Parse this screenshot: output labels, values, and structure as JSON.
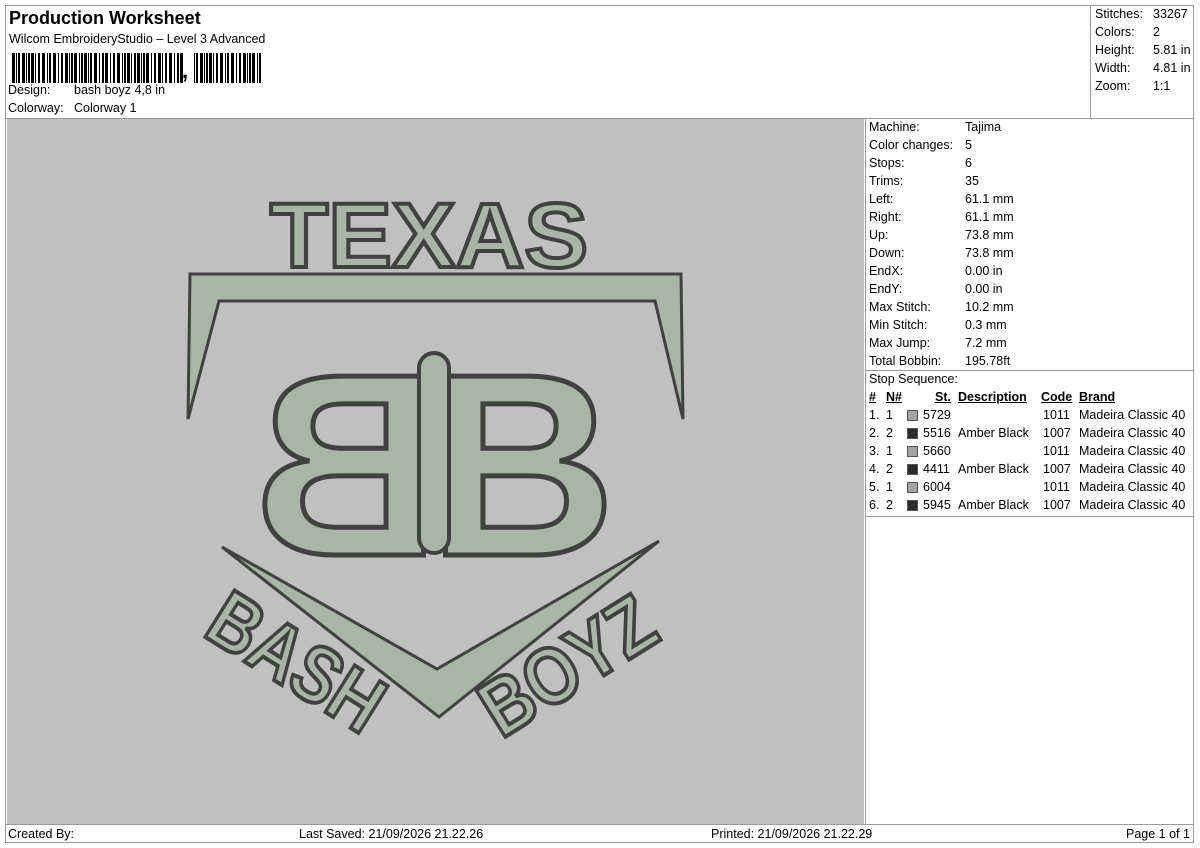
{
  "header": {
    "title": "Production Worksheet",
    "software": "Wilcom EmbroideryStudio – Level 3 Advanced",
    "barcode_tail": ",",
    "design_label": "Design:",
    "design_value": "bash boyz 4,8 in",
    "colorway_label": "Colorway:",
    "colorway_value": "Colorway 1"
  },
  "stats": [
    {
      "label": "Stitches:",
      "value": "33267"
    },
    {
      "label": "Colors:",
      "value": "2"
    },
    {
      "label": "Height:",
      "value": "5.81 in"
    },
    {
      "label": "Width:",
      "value": "4.81 in"
    },
    {
      "label": "Zoom:",
      "value": "1:1"
    }
  ],
  "machine_info": [
    {
      "label": "Machine:",
      "value": "Tajima"
    },
    {
      "label": "Color changes:",
      "value": "5"
    },
    {
      "label": "Stops:",
      "value": "6"
    },
    {
      "label": "Trims:",
      "value": "35"
    },
    {
      "label": "Left:",
      "value": "61.1 mm"
    },
    {
      "label": "Right:",
      "value": "61.1 mm"
    },
    {
      "label": "Up:",
      "value": "73.8 mm"
    },
    {
      "label": "Down:",
      "value": "73.8 mm"
    },
    {
      "label": "EndX:",
      "value": "0.00 in"
    },
    {
      "label": "EndY:",
      "value": "0.00 in"
    },
    {
      "label": "Max Stitch:",
      "value": "10.2 mm"
    },
    {
      "label": "Min Stitch:",
      "value": "0.3 mm"
    },
    {
      "label": "Max Jump:",
      "value": "7.2 mm"
    },
    {
      "label": "Total Bobbin:",
      "value": "195.78ft"
    }
  ],
  "stop_sequence": {
    "title": "Stop Sequence:",
    "columns": [
      "#",
      "N#",
      "St.",
      "Description",
      "Code",
      "Brand"
    ],
    "rows": [
      {
        "num": "1.",
        "n": "1",
        "color": "#a4a4a4",
        "st": "5729",
        "desc": "",
        "code": "1011",
        "brand": "Madeira Classic 40"
      },
      {
        "num": "2.",
        "n": "2",
        "color": "#2b2b2b",
        "st": "5516",
        "desc": "Amber Black",
        "code": "1007",
        "brand": "Madeira Classic 40"
      },
      {
        "num": "3.",
        "n": "1",
        "color": "#a4a4a4",
        "st": "5660",
        "desc": "",
        "code": "1011",
        "brand": "Madeira Classic 40"
      },
      {
        "num": "4.",
        "n": "2",
        "color": "#2b2b2b",
        "st": "4411",
        "desc": "Amber Black",
        "code": "1007",
        "brand": "Madeira Classic 40"
      },
      {
        "num": "5.",
        "n": "1",
        "color": "#a4a4a4",
        "st": "6004",
        "desc": "",
        "code": "1011",
        "brand": "Madeira Classic 40"
      },
      {
        "num": "6.",
        "n": "2",
        "color": "#2b2b2b",
        "st": "5945",
        "desc": "Amber Black",
        "code": "1007",
        "brand": "Madeira Classic 40"
      }
    ]
  },
  "design_art": {
    "top_text": "TEXAS",
    "monogram": "B",
    "left_text": "BASH",
    "right_text": "BOYZ",
    "fill_color": "#a9b5a6",
    "outline_color": "#3f423e",
    "background_color": "#c0c0c0"
  },
  "footer": {
    "created_by": "Created By:",
    "last_saved": "Last Saved: 21/09/2026 21.22.26",
    "printed": "Printed: 21/09/2026 21.22.29",
    "page": "Page 1 of 1"
  }
}
